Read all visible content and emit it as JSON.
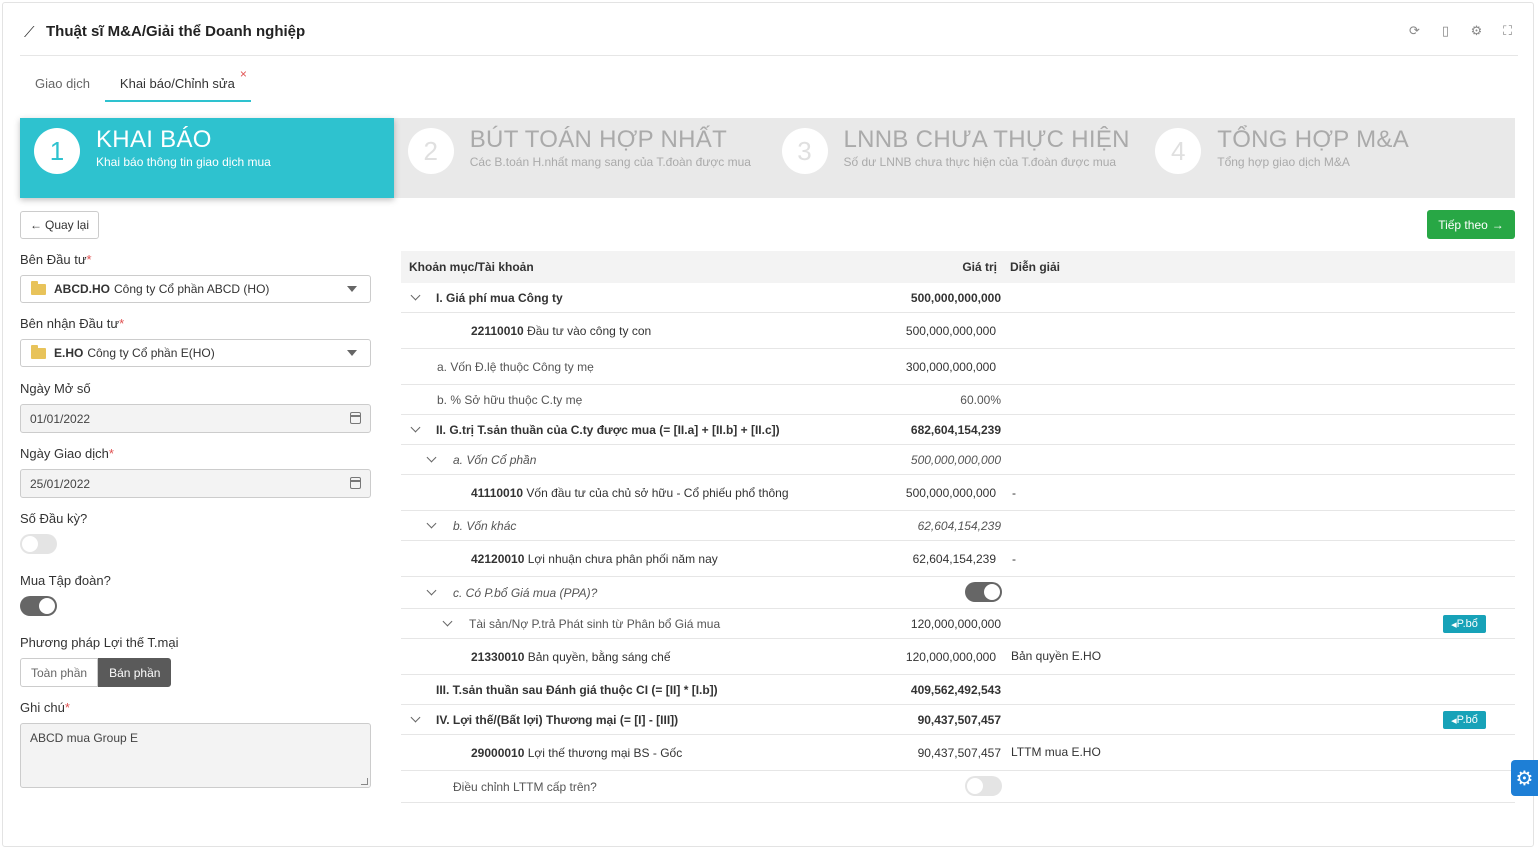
{
  "header": {
    "title": "Thuật sĩ M&A/Giải thể Doanh nghiệp",
    "icons": [
      "refresh-icon",
      "file-icon",
      "gear-icon",
      "fullscreen-icon"
    ]
  },
  "tabs": [
    {
      "label": "Giao dịch"
    },
    {
      "label": "Khai báo/Chỉnh sửa",
      "close": "×"
    }
  ],
  "steps": [
    {
      "num": "1",
      "title": "KHAI BÁO",
      "desc": "Khai báo thông tin giao dịch mua"
    },
    {
      "num": "2",
      "title": "BÚT TOÁN HỢP NHẤT",
      "desc": "Các B.toán H.nhất mang sang của T.đoàn được mua"
    },
    {
      "num": "3",
      "title": "LNNB CHƯA THỰC HIỆN",
      "desc": "Số dư LNNB chưa thực hiện của T.đoàn được mua"
    },
    {
      "num": "4",
      "title": "TỔNG HỢP M&A",
      "desc": "Tổng hợp giao dịch M&A"
    }
  ],
  "buttons": {
    "back": "Quay lại",
    "next": "Tiếp theo"
  },
  "form": {
    "investor_label": "Bên Đầu tư",
    "investor_code": "ABCD.HO",
    "investor_name": "Công ty Cổ phần ABCD (HO)",
    "investee_label": "Bên nhận Đầu tư",
    "investee_code": "E.HO",
    "investee_name": "Công ty Cổ phần E(HO)",
    "open_date_label": "Ngày Mở số",
    "open_date": "01/01/2022",
    "trans_date_label": "Ngày Giao dịch",
    "trans_date": "25/01/2022",
    "opening_label": "Số Đầu kỳ?",
    "opening_on": false,
    "group_label": "Mua Tập đoàn?",
    "group_on": true,
    "method_label": "Phương pháp Lợi thế T.mại",
    "method_opt1": "Toàn phần",
    "method_opt2": "Bán phần",
    "note_label": "Ghi chú",
    "note": "ABCD mua Group E",
    "required": "*"
  },
  "table": {
    "headers": {
      "item": "Khoản mục/Tài khoản",
      "value": "Giá trị",
      "desc": "Diễn giải"
    },
    "rows": {
      "r1": {
        "label": "I. Giá phí mua Công ty",
        "value": "500,000,000,000"
      },
      "r2": {
        "code": "22110010",
        "label": "Đầu tư vào công ty con",
        "value": "500,000,000,000"
      },
      "r3": {
        "label": "a. Vốn Đ.lệ thuộc Công ty mẹ",
        "value": "300,000,000,000"
      },
      "r4": {
        "label": "b. % Sở hữu thuộc C.ty mẹ",
        "value": "60.00%"
      },
      "r5": {
        "label": "II. G.trị T.sản thuần của C.ty được mua (= [II.a] + [II.b] + [II.c])",
        "value": "682,604,154,239"
      },
      "r6": {
        "label": "a. Vốn Cổ phần",
        "value": "500,000,000,000"
      },
      "r7": {
        "code": "41110010",
        "label": "Vốn đầu tư của chủ sở hữu - Cổ phiếu phổ thông",
        "value": "500,000,000,000",
        "desc": "-"
      },
      "r8": {
        "label": "b. Vốn khác",
        "value": "62,604,154,239"
      },
      "r9": {
        "code": "42120010",
        "label": "Lợi nhuận chưa phân phối năm nay",
        "value": "62,604,154,239",
        "desc": "-"
      },
      "r10": {
        "label": "c. Có P.bổ Giá mua (PPA)?",
        "toggle_on": true
      },
      "r11": {
        "label": "Tài sản/Nợ P.trả Phát sinh từ Phân bổ Giá mua",
        "value": "120,000,000,000",
        "badge": "P.bổ"
      },
      "r12": {
        "code": "21330010",
        "label": "Bản quyền, bằng sáng chế",
        "value": "120,000,000,000",
        "desc": "Bản quyền E.HO"
      },
      "r13": {
        "label": "III. T.sản thuần sau Đánh giá thuộc CI (= [II] * [I.b])",
        "value": "409,562,492,543"
      },
      "r14": {
        "label": "IV. Lợi thế/(Bất lợi) Thương mại (= [I] - [III])",
        "value": "90,437,507,457",
        "badge": "P.bổ"
      },
      "r15": {
        "code": "29000010",
        "label": "Lợi thế thương mại BS - Gốc",
        "value": "90,437,507,457",
        "desc": "LTTM mua E.HO"
      },
      "r16": {
        "label": "Điều chỉnh LTTM cấp trên?",
        "toggle_on": false
      }
    }
  }
}
